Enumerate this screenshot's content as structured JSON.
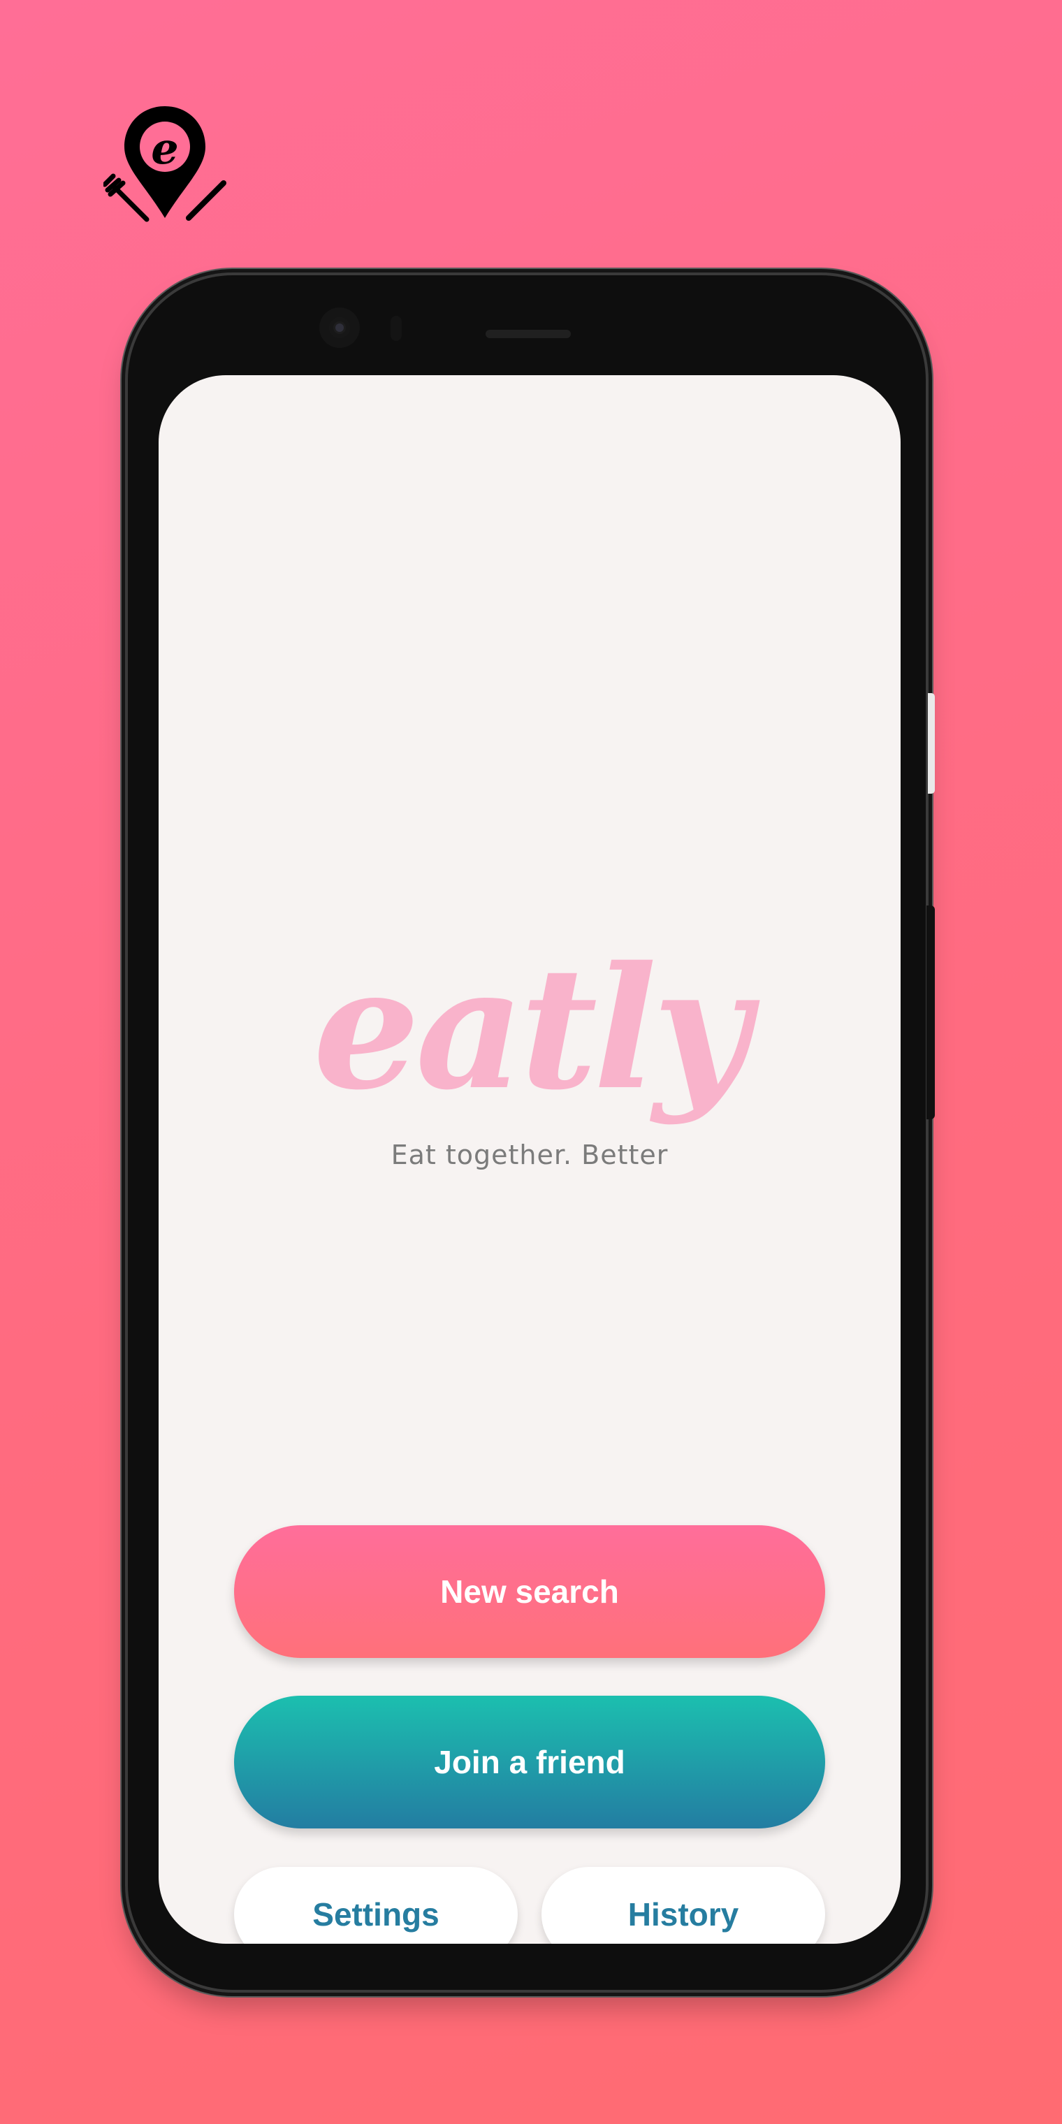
{
  "brand": {
    "icon": "restaurant-location-pin-icon",
    "logo_letter": "e"
  },
  "home": {
    "wordmark": "eatly",
    "tagline": "Eat together. Better"
  },
  "buttons": {
    "new_search": "New search",
    "join_friend": "Join a friend",
    "settings": "Settings",
    "history": "History"
  },
  "colors": {
    "background": "#ff6e8c",
    "wordmark": "#f9b3cb",
    "new_search_gradient": [
      "#ff6e9a",
      "#ff707a"
    ],
    "join_friend_gradient": [
      "#1cbfaf",
      "#237da2"
    ],
    "secondary_button_text": "#267da0",
    "screen_background": "#f7f3f2"
  }
}
